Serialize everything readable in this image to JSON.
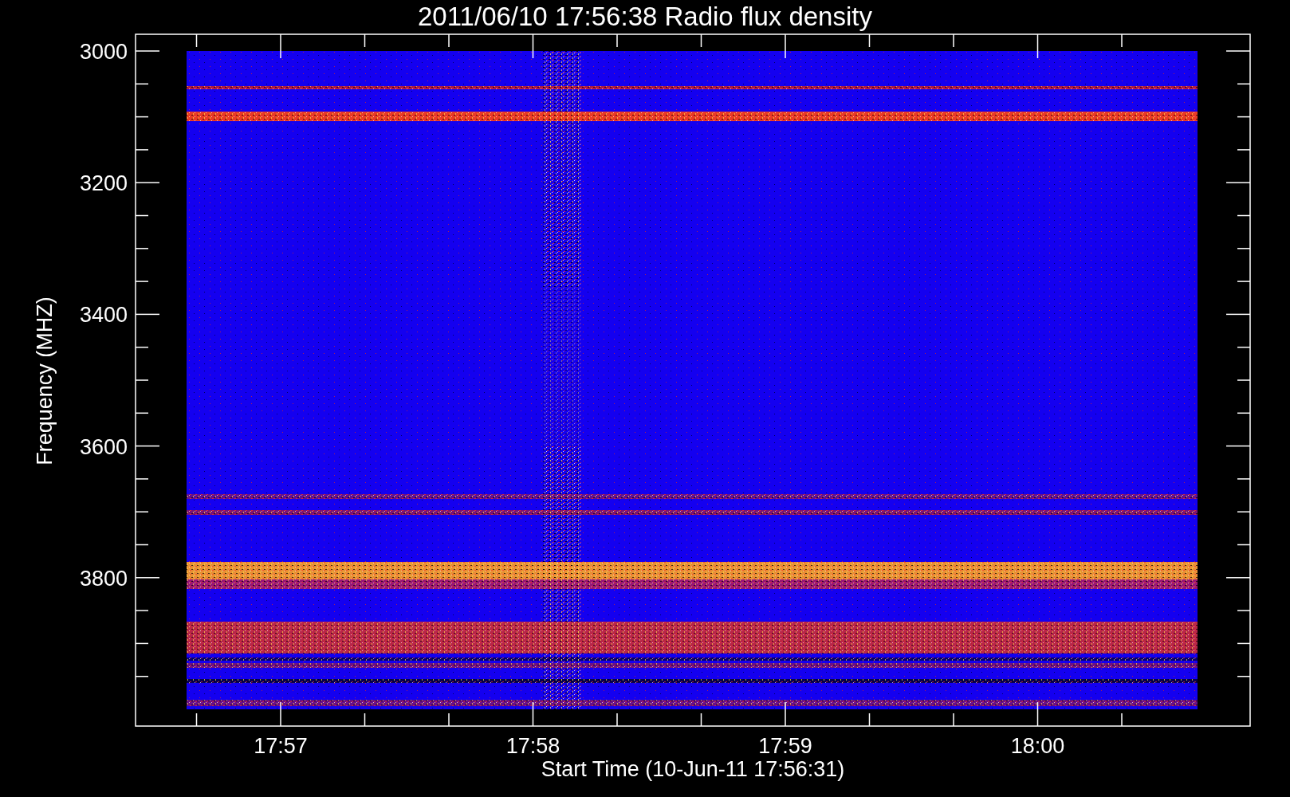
{
  "title": "2011/06/10 17:56:38 Radio flux density",
  "y_axis": {
    "label": "Frequency (MHZ)",
    "ticks": [
      "3000",
      "3200",
      "3400",
      "3600",
      "3800"
    ]
  },
  "x_axis": {
    "label": "Start Time (10-Jun-11 17:56:31)",
    "ticks": [
      "17:57",
      "17:58",
      "17:59",
      "18:00"
    ]
  }
}
